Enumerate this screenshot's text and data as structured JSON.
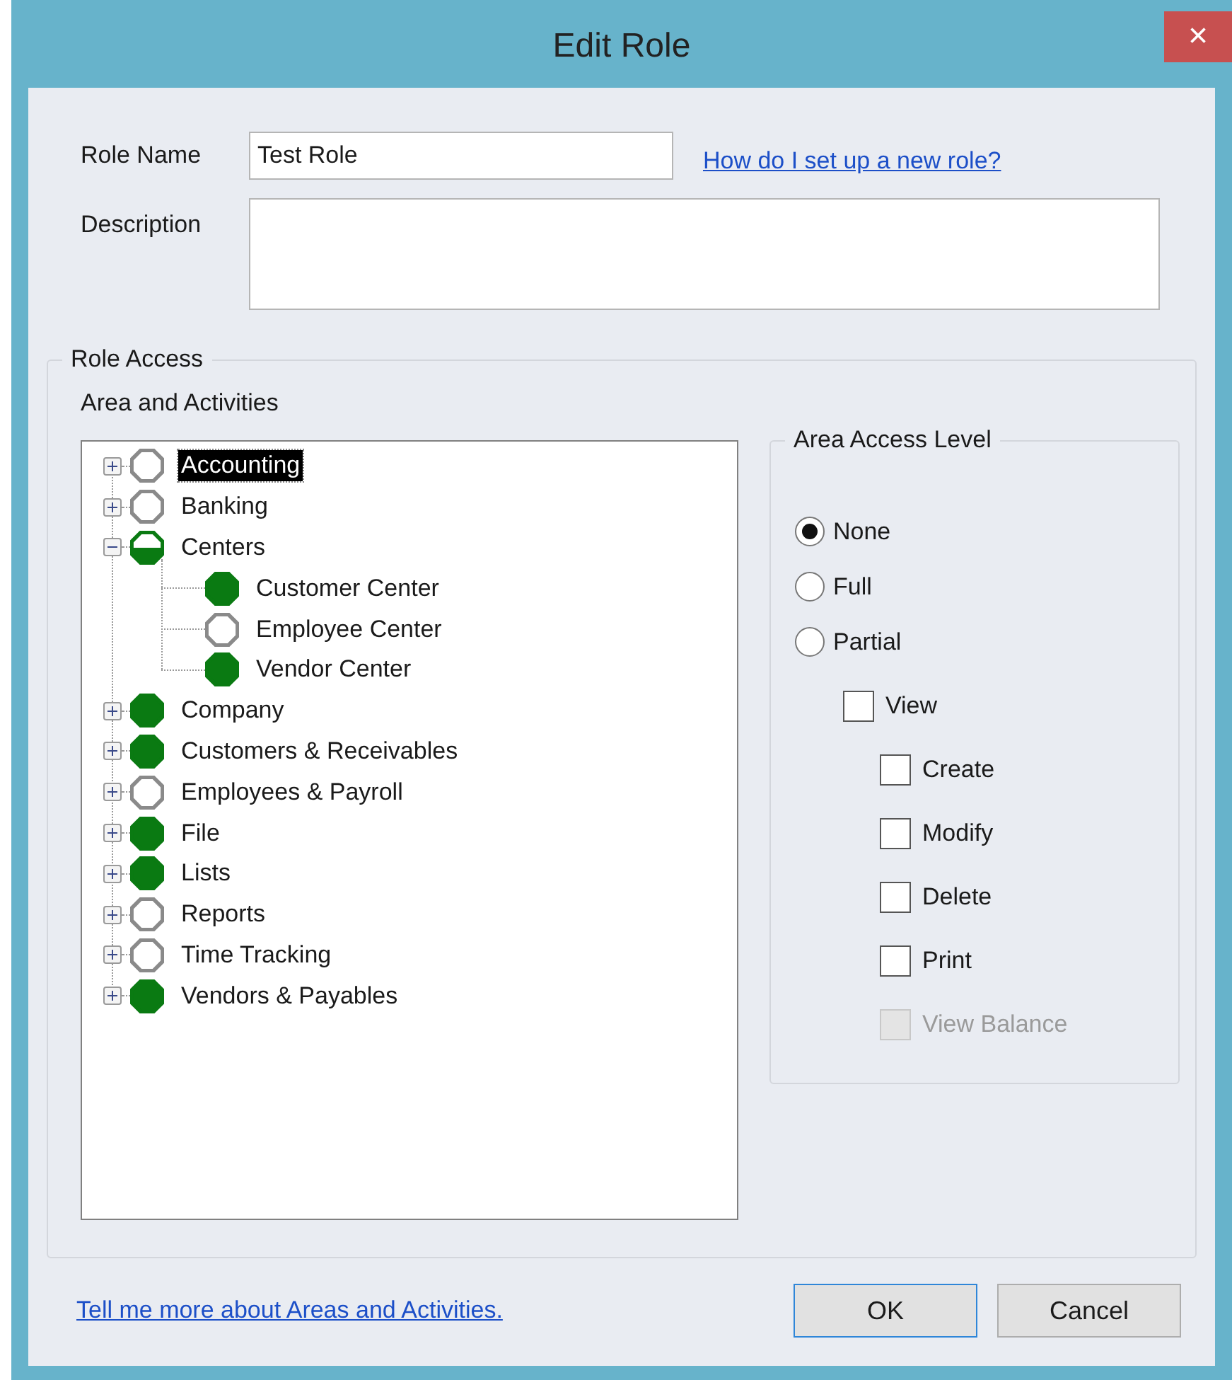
{
  "window": {
    "title": "Edit Role",
    "close": "×"
  },
  "role_name": {
    "label": "Role Name",
    "value": "Test Role"
  },
  "help_link": "How do I set up a new role?",
  "description": {
    "label": "Description"
  },
  "role_access": {
    "title": "Role Access",
    "tree_title": "Area and Activities",
    "tree": [
      {
        "label": "Accounting",
        "kind": "none",
        "expanded": false,
        "selected": true
      },
      {
        "label": "Banking",
        "kind": "none",
        "expanded": false,
        "selected": false
      },
      {
        "label": "Centers",
        "kind": "partial",
        "expanded": true,
        "selected": false,
        "children": [
          {
            "label": "Customer Center",
            "kind": "full",
            "selected": false
          },
          {
            "label": "Employee Center",
            "kind": "none",
            "selected": false
          },
          {
            "label": "Vendor Center",
            "kind": "full",
            "selected": false
          }
        ]
      },
      {
        "label": "Company",
        "kind": "full",
        "expanded": false,
        "selected": false
      },
      {
        "label": "Customers & Receivables",
        "kind": "full",
        "expanded": false,
        "selected": false
      },
      {
        "label": "Employees & Payroll",
        "kind": "none",
        "expanded": false,
        "selected": false
      },
      {
        "label": "File",
        "kind": "full",
        "expanded": false,
        "selected": false
      },
      {
        "label": "Lists",
        "kind": "full",
        "expanded": false,
        "selected": false
      },
      {
        "label": "Reports",
        "kind": "none",
        "expanded": false,
        "selected": false
      },
      {
        "label": "Time Tracking",
        "kind": "none",
        "expanded": false,
        "selected": false
      },
      {
        "label": "Vendors & Payables",
        "kind": "full",
        "expanded": false,
        "selected": false
      }
    ],
    "access_level": {
      "title": "Area Access Level",
      "options": [
        {
          "kind": "radio",
          "label": "None",
          "selected": true
        },
        {
          "kind": "radio",
          "label": "Full",
          "selected": false
        },
        {
          "kind": "radio",
          "label": "Partial",
          "selected": false,
          "children": [
            {
              "kind": "checkbox",
              "label": "View",
              "checked": false,
              "disabled": false,
              "children": [
                {
                  "kind": "checkbox",
                  "label": "Create",
                  "checked": false,
                  "disabled": false
                },
                {
                  "kind": "checkbox",
                  "label": "Modify",
                  "checked": false,
                  "disabled": false
                },
                {
                  "kind": "checkbox",
                  "label": "Delete",
                  "checked": false,
                  "disabled": false
                },
                {
                  "kind": "checkbox",
                  "label": "Print",
                  "checked": false,
                  "disabled": false
                },
                {
                  "kind": "checkbox",
                  "label": "View Balance",
                  "checked": false,
                  "disabled": true
                }
              ]
            }
          ]
        }
      ]
    }
  },
  "footer_link": "Tell me more about Areas and Activities.",
  "buttons": [
    {
      "label": "OK",
      "default": true
    },
    {
      "label": "Cancel",
      "default": false
    }
  ]
}
